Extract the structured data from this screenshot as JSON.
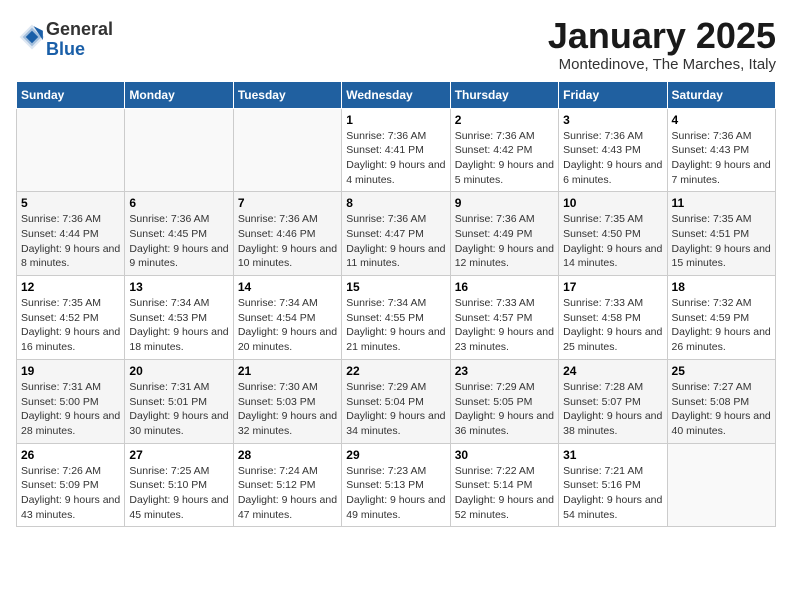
{
  "logo": {
    "line1": "General",
    "line2": "Blue"
  },
  "title": "January 2025",
  "subtitle": "Montedinove, The Marches, Italy",
  "weekdays": [
    "Sunday",
    "Monday",
    "Tuesday",
    "Wednesday",
    "Thursday",
    "Friday",
    "Saturday"
  ],
  "weeks": [
    [
      {
        "day": "",
        "info": ""
      },
      {
        "day": "",
        "info": ""
      },
      {
        "day": "",
        "info": ""
      },
      {
        "day": "1",
        "info": "Sunrise: 7:36 AM\nSunset: 4:41 PM\nDaylight: 9 hours and 4 minutes."
      },
      {
        "day": "2",
        "info": "Sunrise: 7:36 AM\nSunset: 4:42 PM\nDaylight: 9 hours and 5 minutes."
      },
      {
        "day": "3",
        "info": "Sunrise: 7:36 AM\nSunset: 4:43 PM\nDaylight: 9 hours and 6 minutes."
      },
      {
        "day": "4",
        "info": "Sunrise: 7:36 AM\nSunset: 4:43 PM\nDaylight: 9 hours and 7 minutes."
      }
    ],
    [
      {
        "day": "5",
        "info": "Sunrise: 7:36 AM\nSunset: 4:44 PM\nDaylight: 9 hours and 8 minutes."
      },
      {
        "day": "6",
        "info": "Sunrise: 7:36 AM\nSunset: 4:45 PM\nDaylight: 9 hours and 9 minutes."
      },
      {
        "day": "7",
        "info": "Sunrise: 7:36 AM\nSunset: 4:46 PM\nDaylight: 9 hours and 10 minutes."
      },
      {
        "day": "8",
        "info": "Sunrise: 7:36 AM\nSunset: 4:47 PM\nDaylight: 9 hours and 11 minutes."
      },
      {
        "day": "9",
        "info": "Sunrise: 7:36 AM\nSunset: 4:49 PM\nDaylight: 9 hours and 12 minutes."
      },
      {
        "day": "10",
        "info": "Sunrise: 7:35 AM\nSunset: 4:50 PM\nDaylight: 9 hours and 14 minutes."
      },
      {
        "day": "11",
        "info": "Sunrise: 7:35 AM\nSunset: 4:51 PM\nDaylight: 9 hours and 15 minutes."
      }
    ],
    [
      {
        "day": "12",
        "info": "Sunrise: 7:35 AM\nSunset: 4:52 PM\nDaylight: 9 hours and 16 minutes."
      },
      {
        "day": "13",
        "info": "Sunrise: 7:34 AM\nSunset: 4:53 PM\nDaylight: 9 hours and 18 minutes."
      },
      {
        "day": "14",
        "info": "Sunrise: 7:34 AM\nSunset: 4:54 PM\nDaylight: 9 hours and 20 minutes."
      },
      {
        "day": "15",
        "info": "Sunrise: 7:34 AM\nSunset: 4:55 PM\nDaylight: 9 hours and 21 minutes."
      },
      {
        "day": "16",
        "info": "Sunrise: 7:33 AM\nSunset: 4:57 PM\nDaylight: 9 hours and 23 minutes."
      },
      {
        "day": "17",
        "info": "Sunrise: 7:33 AM\nSunset: 4:58 PM\nDaylight: 9 hours and 25 minutes."
      },
      {
        "day": "18",
        "info": "Sunrise: 7:32 AM\nSunset: 4:59 PM\nDaylight: 9 hours and 26 minutes."
      }
    ],
    [
      {
        "day": "19",
        "info": "Sunrise: 7:31 AM\nSunset: 5:00 PM\nDaylight: 9 hours and 28 minutes."
      },
      {
        "day": "20",
        "info": "Sunrise: 7:31 AM\nSunset: 5:01 PM\nDaylight: 9 hours and 30 minutes."
      },
      {
        "day": "21",
        "info": "Sunrise: 7:30 AM\nSunset: 5:03 PM\nDaylight: 9 hours and 32 minutes."
      },
      {
        "day": "22",
        "info": "Sunrise: 7:29 AM\nSunset: 5:04 PM\nDaylight: 9 hours and 34 minutes."
      },
      {
        "day": "23",
        "info": "Sunrise: 7:29 AM\nSunset: 5:05 PM\nDaylight: 9 hours and 36 minutes."
      },
      {
        "day": "24",
        "info": "Sunrise: 7:28 AM\nSunset: 5:07 PM\nDaylight: 9 hours and 38 minutes."
      },
      {
        "day": "25",
        "info": "Sunrise: 7:27 AM\nSunset: 5:08 PM\nDaylight: 9 hours and 40 minutes."
      }
    ],
    [
      {
        "day": "26",
        "info": "Sunrise: 7:26 AM\nSunset: 5:09 PM\nDaylight: 9 hours and 43 minutes."
      },
      {
        "day": "27",
        "info": "Sunrise: 7:25 AM\nSunset: 5:10 PM\nDaylight: 9 hours and 45 minutes."
      },
      {
        "day": "28",
        "info": "Sunrise: 7:24 AM\nSunset: 5:12 PM\nDaylight: 9 hours and 47 minutes."
      },
      {
        "day": "29",
        "info": "Sunrise: 7:23 AM\nSunset: 5:13 PM\nDaylight: 9 hours and 49 minutes."
      },
      {
        "day": "30",
        "info": "Sunrise: 7:22 AM\nSunset: 5:14 PM\nDaylight: 9 hours and 52 minutes."
      },
      {
        "day": "31",
        "info": "Sunrise: 7:21 AM\nSunset: 5:16 PM\nDaylight: 9 hours and 54 minutes."
      },
      {
        "day": "",
        "info": ""
      }
    ]
  ]
}
